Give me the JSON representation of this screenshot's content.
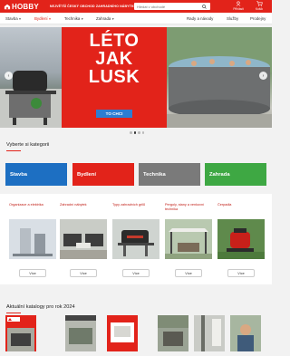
{
  "header": {
    "logo_text": "HOBBY",
    "tagline": "NEJVĚTŠÍ ČESKÝ OBCHOD ZAHRADNÍHO NÁBYTKU A TECHNIKY",
    "search_placeholder": "Hledat v obchodě",
    "user_label": "Přihlásit",
    "cart_label": "Košík"
  },
  "nav": {
    "items": [
      {
        "label": "Stavba"
      },
      {
        "label": "Bydlení"
      },
      {
        "label": "Technika"
      },
      {
        "label": "Zahrada"
      },
      {
        "label": "Rady a návody"
      },
      {
        "label": "Služby"
      },
      {
        "label": "Prodejny"
      }
    ]
  },
  "hero": {
    "headline_line1": "LÉTO",
    "headline_line2": "JAK",
    "headline_line3": "LUSK",
    "cta_label": "TO CHCI",
    "slide_count": 4,
    "active_slide": 2
  },
  "categories": {
    "title": "Vyberte si kategorii",
    "items": [
      {
        "label": "Stavba",
        "color": "#1d6fc2"
      },
      {
        "label": "Bydlení",
        "color": "#e2231a"
      },
      {
        "label": "Technika",
        "color": "#7a7a7a"
      },
      {
        "label": "Zahrada",
        "color": "#3ea843"
      }
    ]
  },
  "products": {
    "items": [
      {
        "title": "Organizace a elektrika",
        "button": "Více"
      },
      {
        "title": "Zahradní nábytek",
        "button": "Více"
      },
      {
        "title": "Typy zahradních grilů",
        "button": "Více"
      },
      {
        "title": "Pergoly, stany a venkovní technika",
        "button": "Více"
      },
      {
        "title": "Čerpadla",
        "button": "Více"
      }
    ]
  },
  "catalogs": {
    "title": "Aktuální katalogy pro rok 2024"
  },
  "colors": {
    "brand_red": "#e2231a",
    "cta_blue": "#2d7dd2"
  }
}
